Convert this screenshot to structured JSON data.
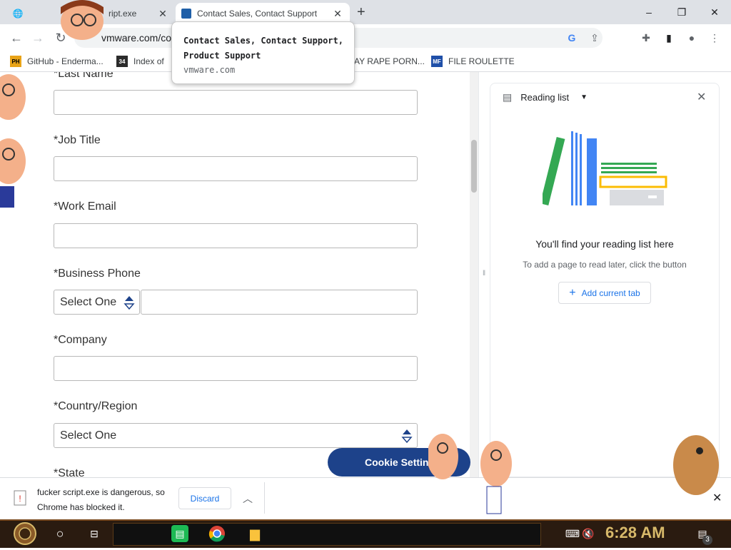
{
  "browser": {
    "tabs": [
      {
        "title": "ript.exe",
        "close": "✕"
      },
      {
        "title": "Contact Sales, Contact Support",
        "close": "✕"
      }
    ],
    "new_tab": "+",
    "window_controls": {
      "minimize": "–",
      "maximize": "❐",
      "close": "✕"
    },
    "url": "vmware.com/co",
    "nav": {
      "back": "←",
      "forward": "→",
      "reload": "↻"
    },
    "toolbar_icons": {
      "google": "G",
      "share": "⇪",
      "extensions": "✚",
      "sidepanel": "▮",
      "profile": "●",
      "menu": "⋮"
    }
  },
  "bookmarks": [
    {
      "label": "GitHub - Enderma...",
      "icon": "PH",
      "color": "#e8a317"
    },
    {
      "label": "Index of",
      "icon": "34",
      "color": "#2b2b2b"
    },
    {
      "label": "AY RAPE PORN...",
      "icon": "",
      "color": "#ffffff"
    },
    {
      "label": "FILE ROULETTE",
      "icon": "MF",
      "color": "#1f4fa8"
    }
  ],
  "tooltip": {
    "title": "Contact Sales, Contact Support, Product Support",
    "url": "vmware.com"
  },
  "form": {
    "last_name_label": "*Last Name",
    "job_title_label": "*Job Title",
    "work_email_label": "*Work Email",
    "business_phone_label": "*Business Phone",
    "phone_select": "Select One",
    "company_label": "*Company",
    "country_label": "*Country/Region",
    "country_select": "Select One",
    "state_label": "*State"
  },
  "cookie_button": "Cookie Settings",
  "reading_list": {
    "header": "Reading list",
    "title": "You'll find your reading list here",
    "description": "To add a page to read later, click the button",
    "add_button": "Add current tab",
    "close": "✕"
  },
  "download": {
    "message": "fucker script.exe is dangerous, so Chrome has blocked it.",
    "discard": "Discard",
    "chevron": "︿",
    "close": "✕"
  },
  "taskbar": {
    "time": "6:28 AM",
    "notification_count": "3"
  },
  "colors": {
    "accent": "#1a73e8",
    "cookie_bg": "#1d428a",
    "taskbar_bg": "#2a1b10",
    "clock": "#d7b96a"
  }
}
